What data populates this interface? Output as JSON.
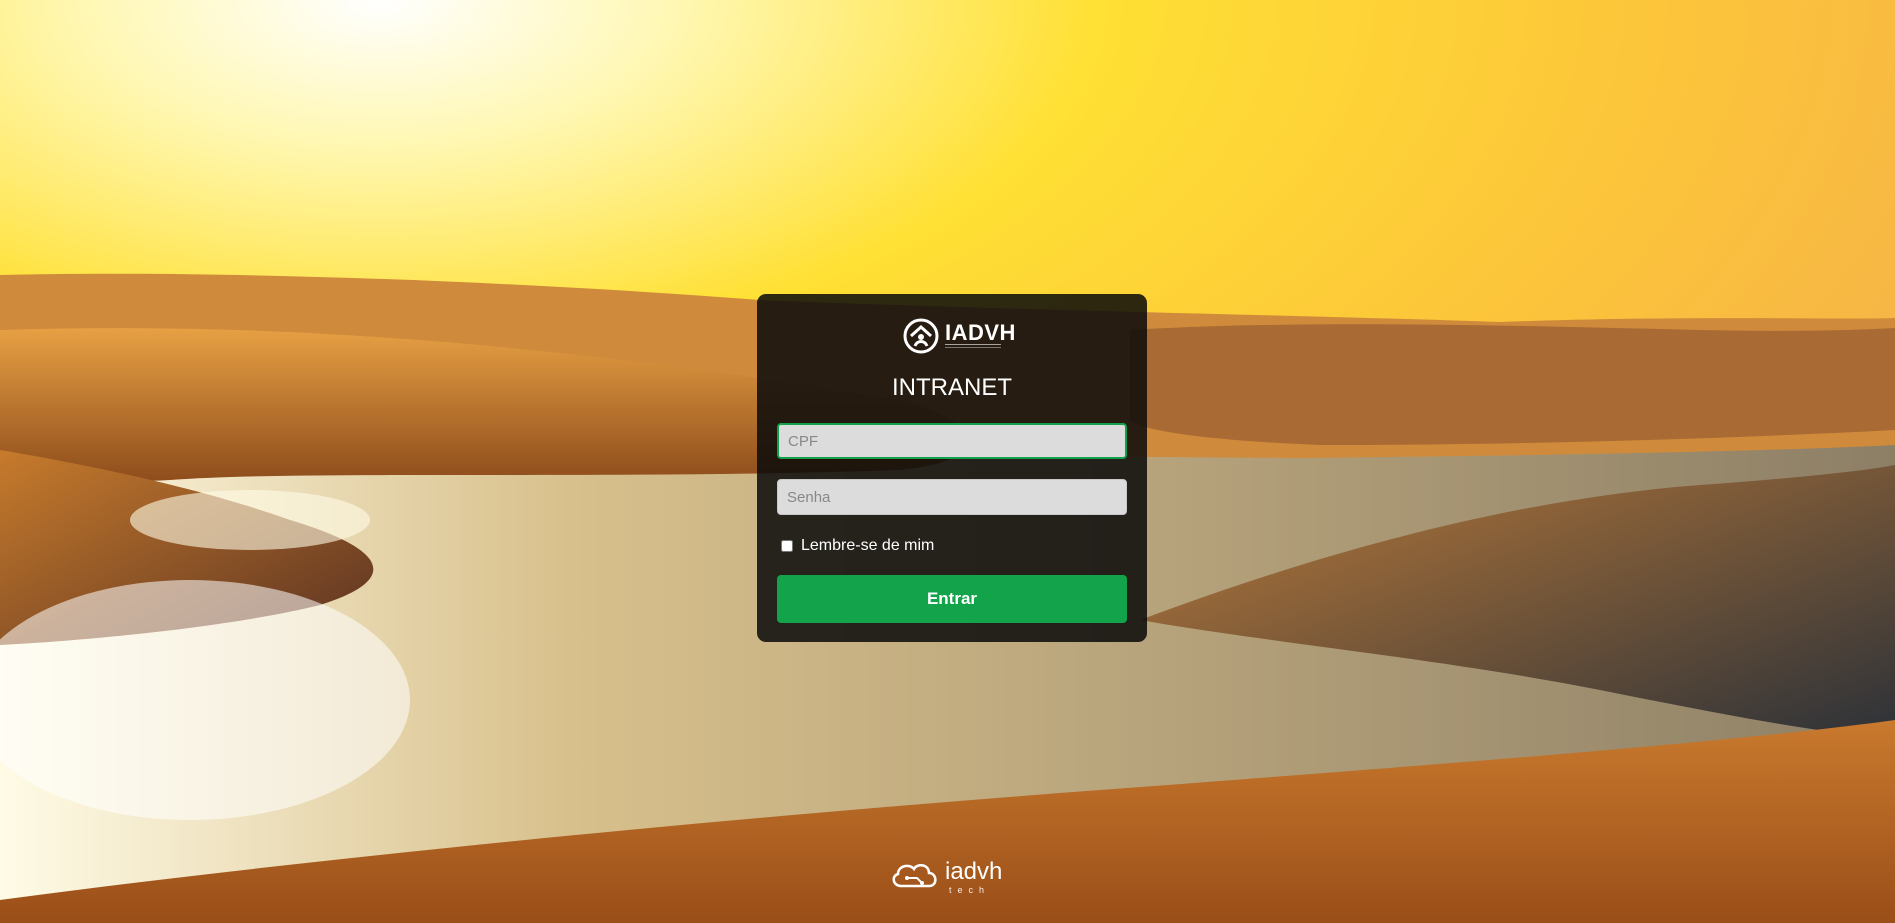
{
  "background": {
    "description_icon": "desert-dunes-lagoon-sunset",
    "sky_colors": [
      "#fffbe0",
      "#ffe13a",
      "#f8b83a"
    ],
    "sand_color": "#c77a2a",
    "water_color": "#b8a582"
  },
  "login": {
    "logo_text": "IADVH",
    "title": "INTRANET",
    "cpf_placeholder": "CPF",
    "password_placeholder": "Senha",
    "remember_label": "Lembre-se de mim",
    "remember_checked": false,
    "submit_label": "Entrar",
    "accent_color": "#12a34b"
  },
  "footer": {
    "brand": "iadvh",
    "sub": "tech"
  }
}
